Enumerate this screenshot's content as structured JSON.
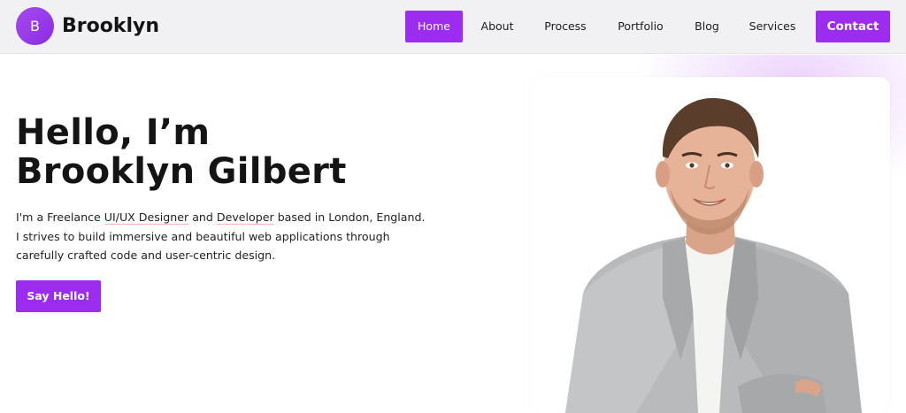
{
  "header": {
    "logo_letter": "B",
    "brand_name": "Brooklyn",
    "nav": {
      "home": "Home",
      "about": "About",
      "process": "Process",
      "portfolio": "Portfolio",
      "blog": "Blog",
      "services": "Services"
    },
    "contact_label": "Contact",
    "active_item": "Home"
  },
  "hero": {
    "title_line1": "Hello, I’m",
    "title_line2": "Brooklyn Gilbert",
    "desc_part1": "I'm a Freelance ",
    "desc_role1": "UI/UX Designer",
    "desc_part2": " and ",
    "desc_role2": "Developer",
    "desc_part3": " based in London, England. I strives to build immersive and beautiful web applications through carefully crafted code and user-centric design.",
    "cta_label": "Say Hello!"
  },
  "colors": {
    "accent": "#9b2cf0",
    "header_bg": "#f1f1f4",
    "text": "#141414"
  },
  "icons": {
    "logo": "letter-b-circle-logo",
    "portrait": "person-photo"
  }
}
